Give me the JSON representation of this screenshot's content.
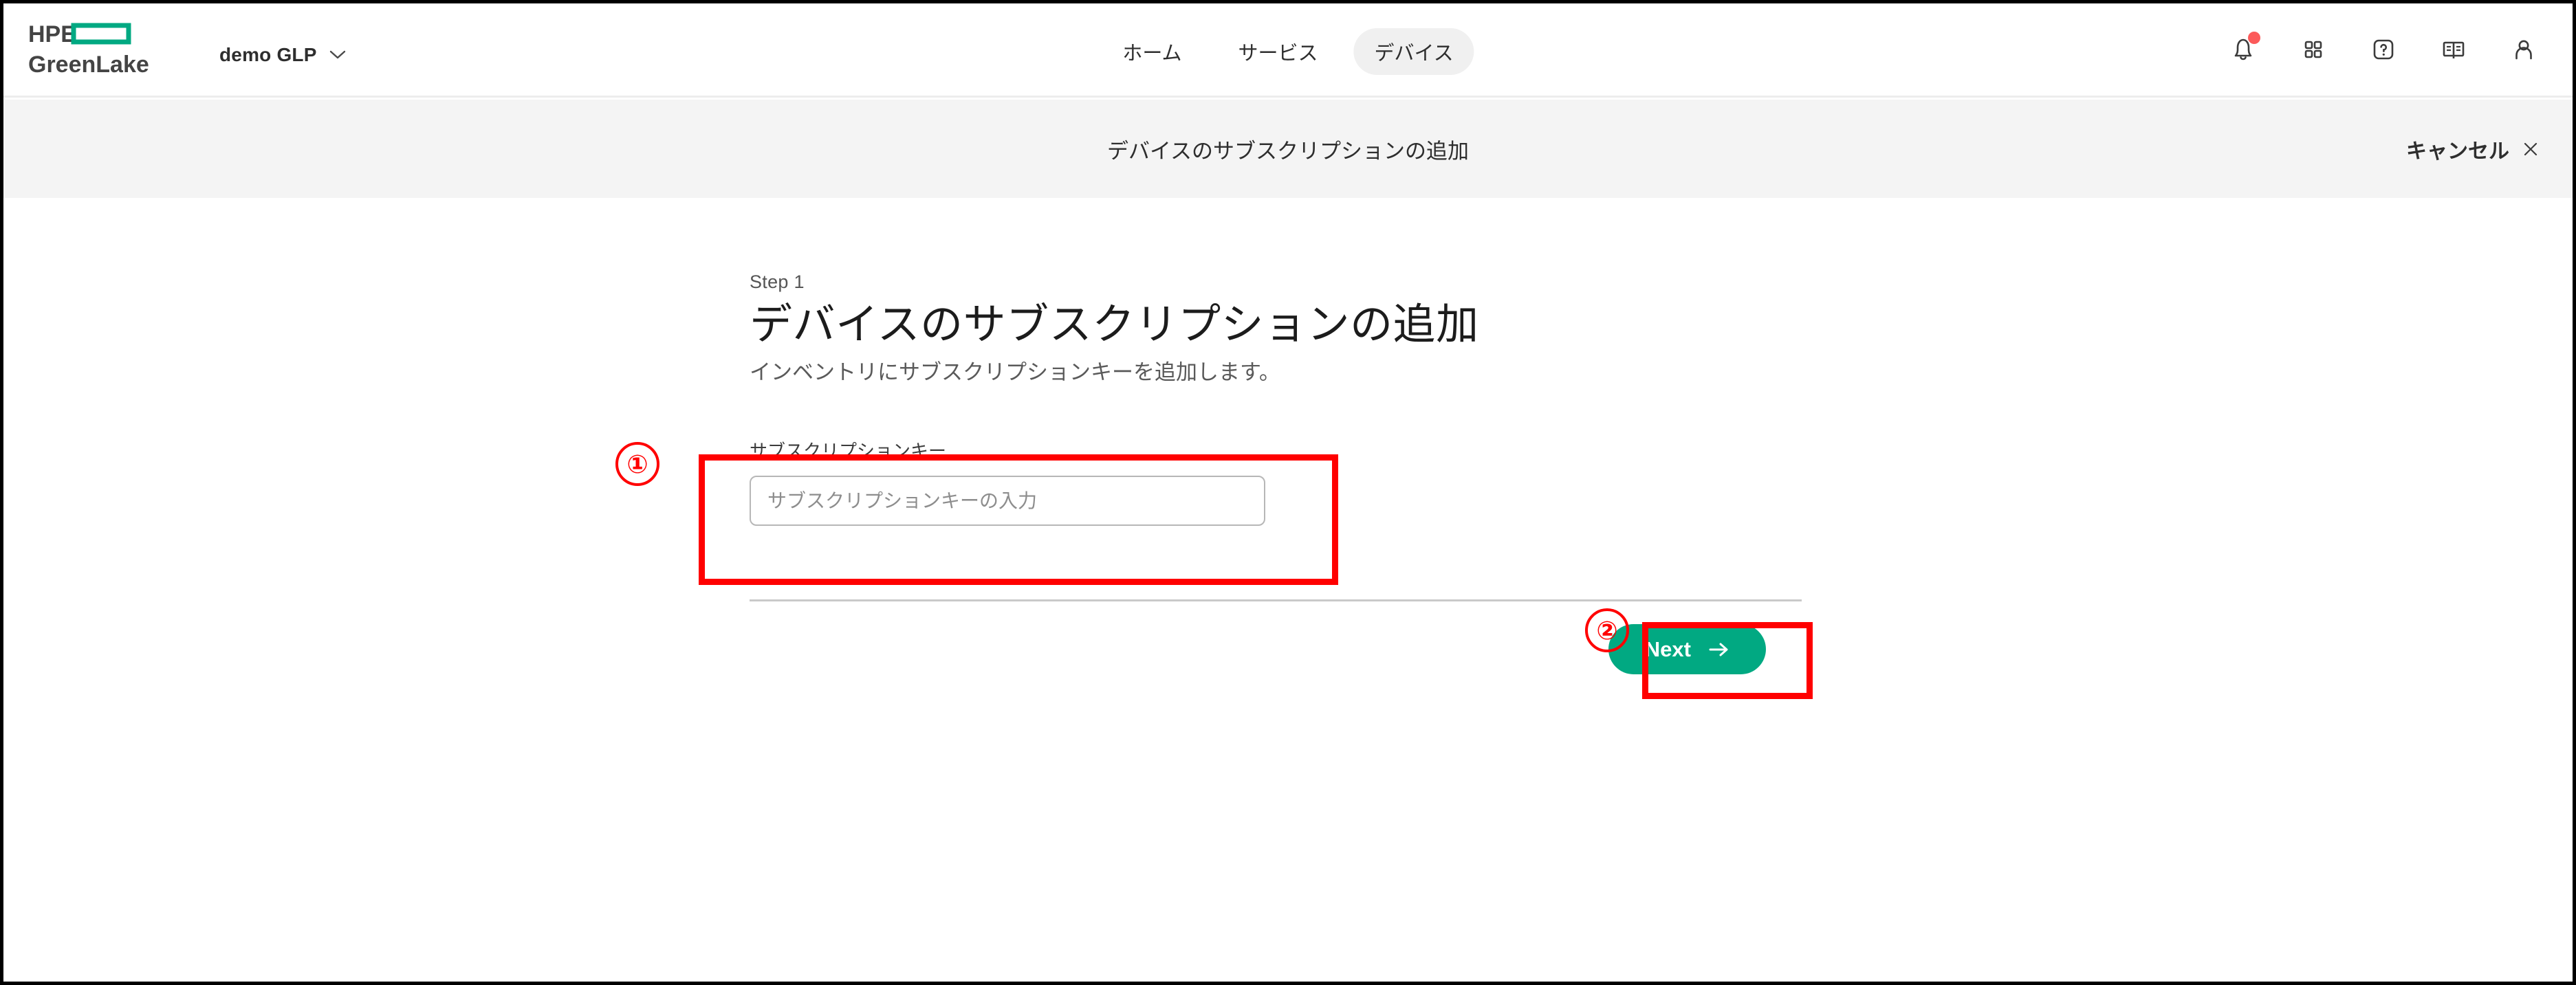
{
  "brand": {
    "logo_line1": "HPE",
    "logo_line2": "GreenLake",
    "logo_green": "#01a982",
    "logo_dark": "#444444"
  },
  "header": {
    "org_name": "demo GLP",
    "org_chevron_icon": "chevron-down-icon",
    "nav": [
      {
        "label": "ホーム",
        "active": false
      },
      {
        "label": "サービス",
        "active": false
      },
      {
        "label": "デバイス",
        "active": true
      }
    ],
    "icons": [
      {
        "name": "bell-icon",
        "has_badge": true,
        "badge_color": "#fc5a5a"
      },
      {
        "name": "apps-grid-icon",
        "has_badge": false
      },
      {
        "name": "help-question-icon",
        "has_badge": false
      },
      {
        "name": "book-docs-icon",
        "has_badge": false
      },
      {
        "name": "user-profile-icon",
        "has_badge": false
      }
    ]
  },
  "subheader": {
    "title": "デバイスのサブスクリプションの追加",
    "cancel_label": "キャンセル",
    "close_icon": "close-x-icon",
    "background": "#f4f4f4"
  },
  "main": {
    "step_kicker": "Step 1",
    "heading": "デバイスのサブスクリプションの追加",
    "subtitle": "インベントリにサブスクリプションキーを追加します。",
    "field": {
      "label": "サブスクリプションキー",
      "placeholder": "サブスクリプションキーの入力",
      "value": ""
    },
    "next_button": {
      "label": "Next",
      "arrow_icon": "arrow-right-icon",
      "color": "#01a982"
    }
  },
  "annotations": {
    "color": "#ff0000",
    "markers": [
      {
        "label": "①",
        "target": "subscription-key-field"
      },
      {
        "label": "②",
        "target": "next-button"
      }
    ]
  }
}
